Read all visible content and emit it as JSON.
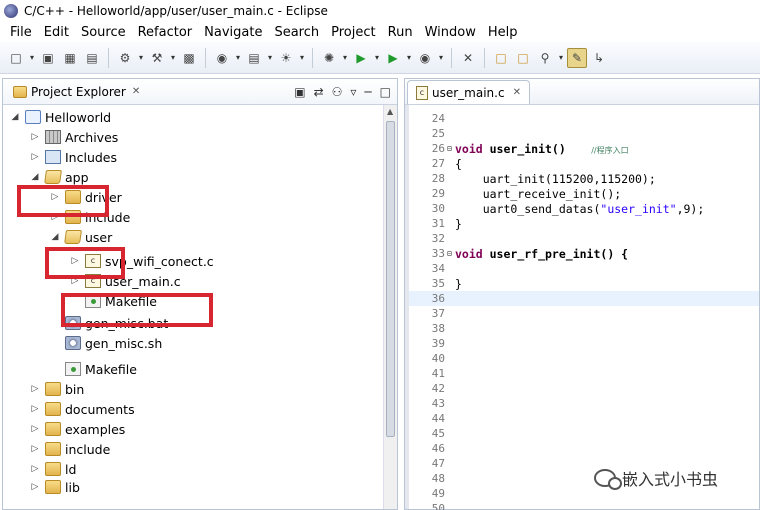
{
  "window": {
    "title": "C/C++ - Helloworld/app/user/user_main.c - Eclipse"
  },
  "menu": [
    "File",
    "Edit",
    "Source",
    "Refactor",
    "Navigate",
    "Search",
    "Project",
    "Run",
    "Window",
    "Help"
  ],
  "toolbar_icons": [
    "new-icon",
    "save-icon",
    "save-all-icon",
    "print-icon",
    "build-config-icon",
    "build-icon",
    "binary-icon",
    "new-cpp-class-icon",
    "new-source-folder-icon",
    "new-cpp-file-icon",
    "debug-icon",
    "run-icon",
    "external-tools-icon",
    "toggle-breakpoint-icon",
    "open-folder-icon",
    "open-type-icon",
    "search-icon",
    "mark-occurrences-icon",
    "next-annotation-icon"
  ],
  "explorer": {
    "title": "Project Explorer",
    "items": [
      {
        "label": "Helloworld"
      },
      {
        "label": "Archives"
      },
      {
        "label": "Includes"
      },
      {
        "label": "app"
      },
      {
        "label": "driver"
      },
      {
        "label": "include"
      },
      {
        "label": "user"
      },
      {
        "label": "svp_wifi_conect.c"
      },
      {
        "label": "user_main.c"
      },
      {
        "label": "Makefile"
      },
      {
        "label": "gen_misc.bat"
      },
      {
        "label": "gen_misc.sh"
      },
      {
        "label": "Makefile"
      },
      {
        "label": "bin"
      },
      {
        "label": "documents"
      },
      {
        "label": "examples"
      },
      {
        "label": "include"
      },
      {
        "label": "ld"
      },
      {
        "label": "lib"
      }
    ]
  },
  "editor": {
    "tab": "user_main.c",
    "lines": [
      {
        "n": "24",
        "text": ""
      },
      {
        "n": "25",
        "text": ""
      },
      {
        "n": "26",
        "text": "void user_init()",
        "comment": "//程序入口"
      },
      {
        "n": "27",
        "text": "{"
      },
      {
        "n": "28",
        "text": "    uart_init(115200,115200);"
      },
      {
        "n": "29",
        "text": "    uart_receive_init();"
      },
      {
        "n": "30",
        "text": "    uart0_send_datas(",
        "str": "\"user_init\"",
        "tail": ",9);"
      },
      {
        "n": "31",
        "text": "}"
      },
      {
        "n": "32",
        "text": ""
      },
      {
        "n": "33",
        "text": "void user_rf_pre_init() {"
      },
      {
        "n": "34",
        "text": ""
      },
      {
        "n": "35",
        "text": "}"
      },
      {
        "n": "36",
        "text": ""
      },
      {
        "n": "37",
        "text": ""
      },
      {
        "n": "38",
        "text": ""
      },
      {
        "n": "39",
        "text": ""
      },
      {
        "n": "40",
        "text": ""
      },
      {
        "n": "41",
        "text": ""
      },
      {
        "n": "42",
        "text": ""
      },
      {
        "n": "43",
        "text": ""
      },
      {
        "n": "44",
        "text": ""
      },
      {
        "n": "45",
        "text": ""
      },
      {
        "n": "46",
        "text": ""
      },
      {
        "n": "47",
        "text": ""
      },
      {
        "n": "48",
        "text": ""
      },
      {
        "n": "49",
        "text": ""
      },
      {
        "n": "50",
        "text": ""
      }
    ]
  },
  "watermark": "嵌入式小书虫"
}
